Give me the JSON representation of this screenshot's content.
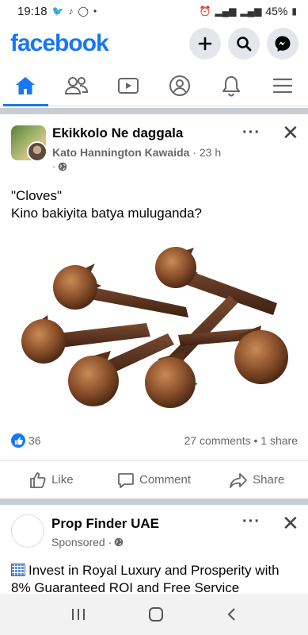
{
  "status_bar": {
    "time": "19:18",
    "battery": "45%"
  },
  "header": {
    "logo": "facebook"
  },
  "nav_tabs": [
    "home",
    "friends",
    "watch",
    "profile",
    "notifications",
    "menu"
  ],
  "post1": {
    "group": "Ekikkolo Ne daggala",
    "author": "Kato Hannington Kawaida",
    "time": " · 23 h",
    "text_line1": "\"Cloves\"",
    "text_line2": "Kino bakiyita batya muluganda?",
    "reactions_count": "36",
    "comments_shares": "27 comments • 1 share",
    "actions": {
      "like": "Like",
      "comment": "Comment",
      "share": "Share"
    }
  },
  "post2": {
    "name": "Prop Finder UAE",
    "sponsored": "Sponsored ·",
    "text": "Invest in Royal Luxury and Prosperity with 8% Guaranteed ROI and Free Service"
  },
  "colors": {
    "brand": "#1877f2",
    "separator": "#c9ccd1"
  }
}
